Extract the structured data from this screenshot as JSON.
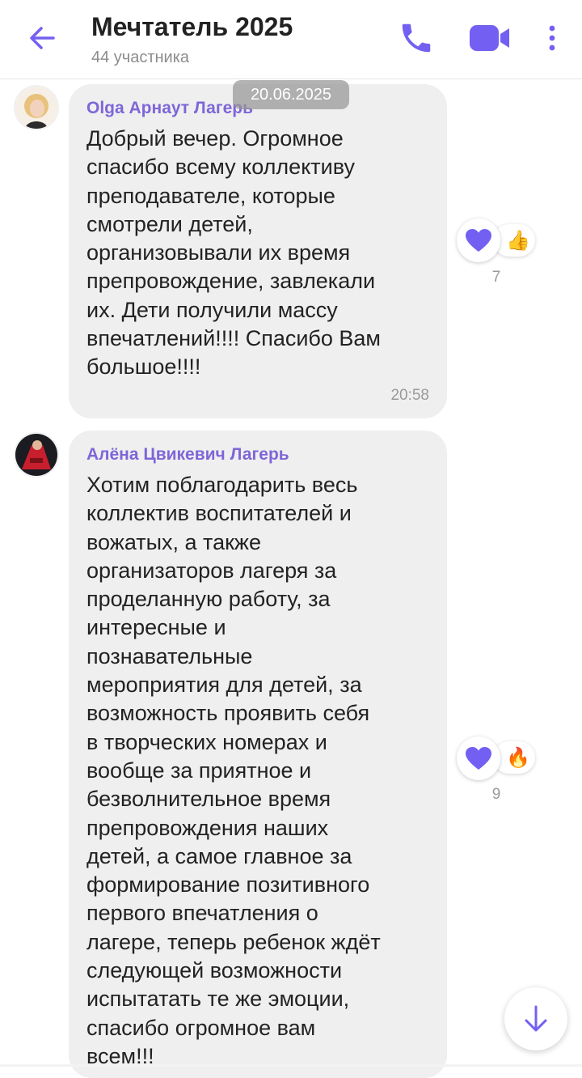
{
  "header": {
    "title": "Мечтатель 2025",
    "subtitle": "44 участника",
    "icons": {
      "back": "arrow-left-icon",
      "call": "phone-icon",
      "video": "video-camera-icon",
      "more": "more-vertical-icon"
    },
    "accent_color": "#7360f2"
  },
  "date_separator": "20.06.2025",
  "messages": [
    {
      "sender": "Olga Арнаут Лагерь",
      "text": "Добрый вечер. Огромное\nспасибо всему коллективу\nпреподавателе, которые\nсмотрели детей,\nорганизовывали их время\nпрепровождение, завлекали\nих. Дети получили массу\nвпечатлений!!!! Спасибо Вам\nбольшое!!!!",
      "time": "20:58",
      "reactions": {
        "main": "purple-heart",
        "secondary": "👍",
        "count": "7"
      }
    },
    {
      "sender": "Алёна Цвикевич Лагерь",
      "text": "Хотим поблагодарить весь\nколлектив воспитателей и\nвожатых, а также\nорганизаторов лагеря за\nпроделанную работу, за\nинтересные и\nпознавательные\nмероприятия для детей, за\nвозможность проявить себя\nв творческих номерах и\nвообще за приятное и\nбезволнительное время\nпрепровождения наших\nдетей, а самое главное за\nформирование позитивного\nпервого впечатления о\nлагере, теперь ребенок ждёт\nследующей возможности\nиспытатать те же эмоции,\nспасибо огромное вам\nвсем!!!",
      "reactions": {
        "main": "purple-heart",
        "secondary": "🔥",
        "count": "9"
      }
    }
  ],
  "scroll_button": {
    "icon": "arrow-down-icon"
  }
}
